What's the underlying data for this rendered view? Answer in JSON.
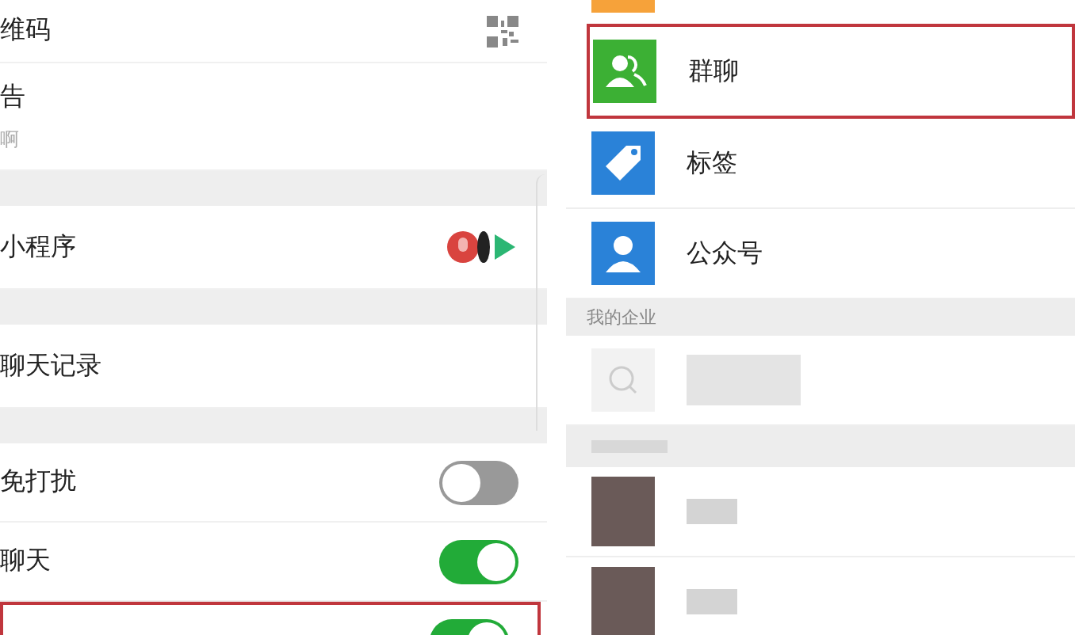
{
  "left_panel": {
    "rows": [
      {
        "kind": "qr",
        "label": "维码",
        "highlighted": false
      },
      {
        "kind": "notice",
        "label": "告",
        "subtitle": "啊",
        "highlighted": false
      },
      {
        "kind": "gap"
      },
      {
        "kind": "apps",
        "label": "小程序",
        "highlighted": false
      },
      {
        "kind": "gap"
      },
      {
        "kind": "link",
        "label": "聊天记录",
        "highlighted": false
      },
      {
        "kind": "gap"
      },
      {
        "kind": "toggle",
        "label": "免打扰",
        "on": false,
        "highlighted": false
      },
      {
        "kind": "toggle",
        "label": "聊天",
        "on": true,
        "highlighted": false
      },
      {
        "kind": "toggle",
        "label": "",
        "on": true,
        "highlighted": true
      }
    ]
  },
  "right_panel": {
    "rows": [
      {
        "kind": "partial"
      },
      {
        "kind": "group",
        "label": "群聊",
        "highlighted": true
      },
      {
        "kind": "tag",
        "label": "标签",
        "highlighted": false
      },
      {
        "kind": "official",
        "label": "公众号",
        "highlighted": false
      },
      {
        "kind": "header",
        "label": "我的企业"
      },
      {
        "kind": "blurred-search"
      },
      {
        "kind": "blurred-header"
      },
      {
        "kind": "blurred-contact"
      },
      {
        "kind": "blurred-contact"
      }
    ]
  }
}
